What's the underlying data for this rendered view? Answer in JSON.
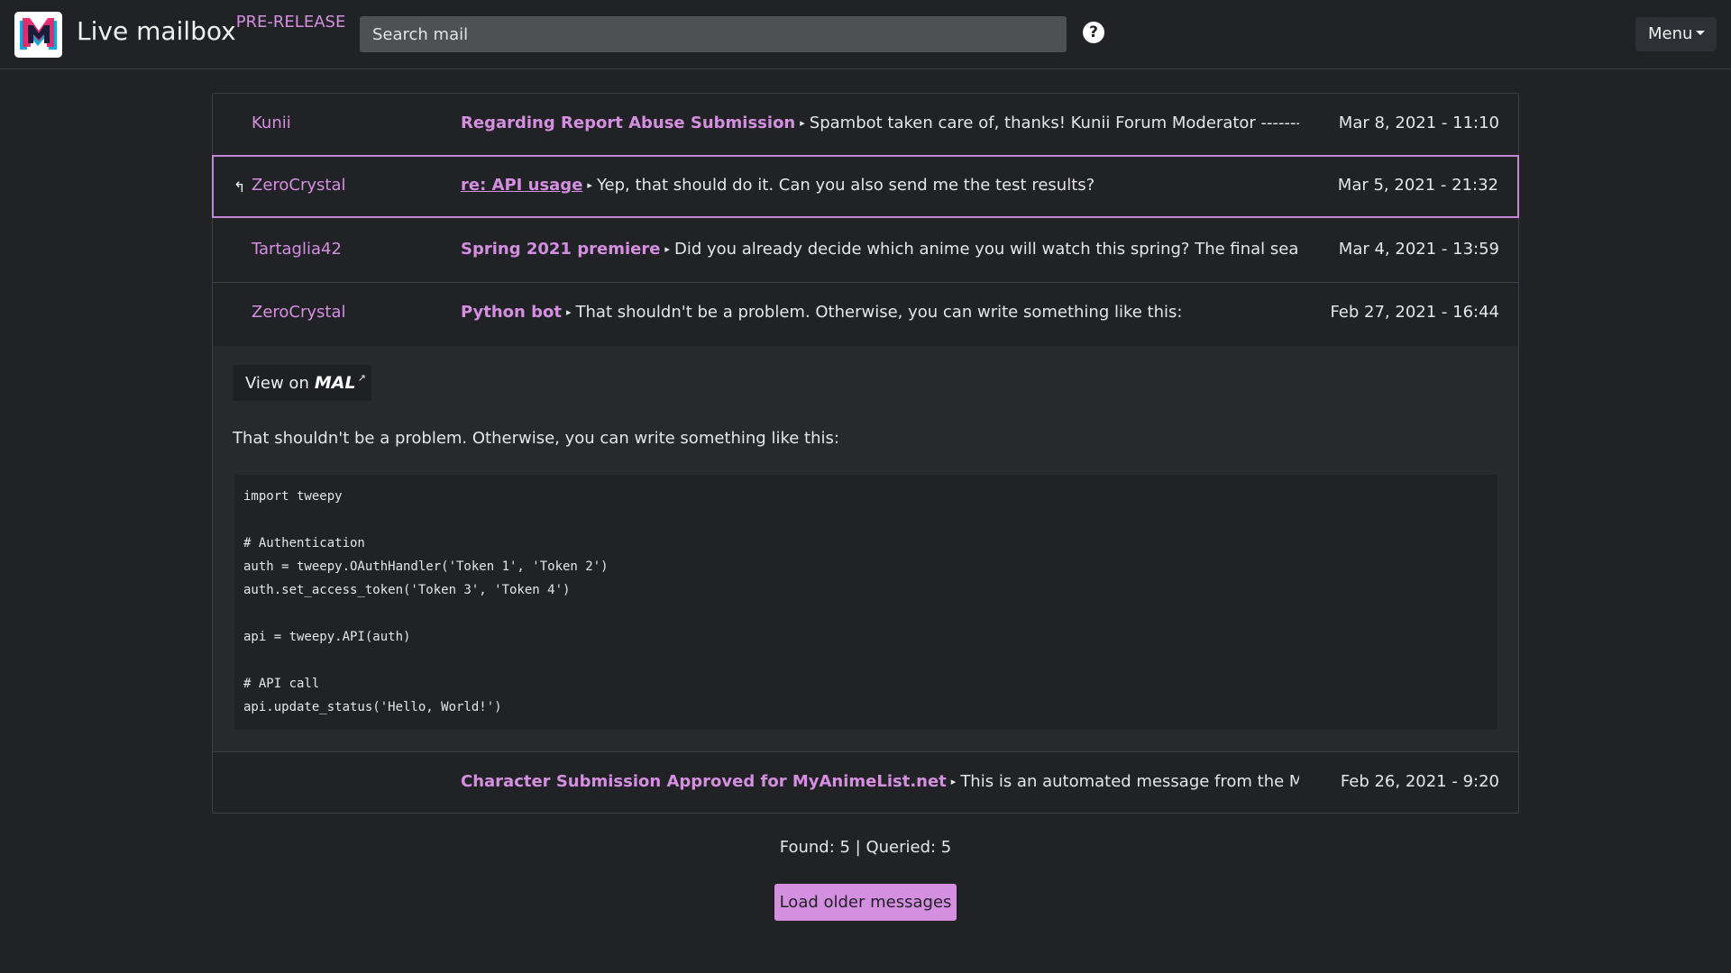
{
  "header": {
    "brand": "Live mailbox",
    "badge": "PRE-RELEASE",
    "search_placeholder": "Search mail",
    "help_glyph": "?",
    "menu_label": "Menu"
  },
  "messages": [
    {
      "sender": "Kunii",
      "subject": "Regarding Report Abuse Submission",
      "preview": "Spambot taken care of, thanks! Kunii Forum Moderator ----------------...",
      "date": "Mar 8, 2021 - 11:10",
      "replied": false,
      "selected": false
    },
    {
      "sender": "ZeroCrystal",
      "subject": "re: API usage",
      "preview": "Yep, that should do it. Can you also send me the test results?",
      "date": "Mar 5, 2021 - 21:32",
      "replied": true,
      "selected": true
    },
    {
      "sender": "Tartaglia42",
      "subject": "Spring 2021 premiere",
      "preview": "Did you already decide which anime you will watch this spring? The final season of ...",
      "date": "Mar 4, 2021 - 13:59",
      "replied": false,
      "selected": false
    },
    {
      "sender": "ZeroCrystal",
      "subject": "Python bot",
      "preview": "That shouldn't be a problem. Otherwise, you can write something like this:",
      "date": "Feb 27, 2021 - 16:44",
      "replied": false,
      "selected": false
    },
    {
      "sender": "",
      "subject": "Character Submission Approved for MyAnimeList.net",
      "preview": "This is an automated message from the MyAnime...",
      "date": "Feb 26, 2021 - 9:20",
      "replied": false,
      "selected": false
    }
  ],
  "expanded": {
    "view_on_label": "View on",
    "mal_logo_text": "MAL",
    "body": "That shouldn't be a problem. Otherwise, you can write something like this:",
    "code": "import tweepy\n\n# Authentication\nauth = tweepy.OAuthHandler('Token 1', 'Token 2')\nauth.set_access_token('Token 3', 'Token 4')\n\napi = tweepy.API(auth)\n\n# API call\napi.update_status('Hello, World!')"
  },
  "footer": {
    "counts": "Found: 5 | Queried: 5",
    "load_label": "Load older messages"
  },
  "colors": {
    "accent": "#d58fe0",
    "background": "#212226",
    "expanded_background": "#28292d"
  },
  "icons": {
    "reply": "reply-arrow-icon",
    "help": "question-circle-icon",
    "external": "external-link-icon",
    "caret": "caret-down-icon"
  }
}
